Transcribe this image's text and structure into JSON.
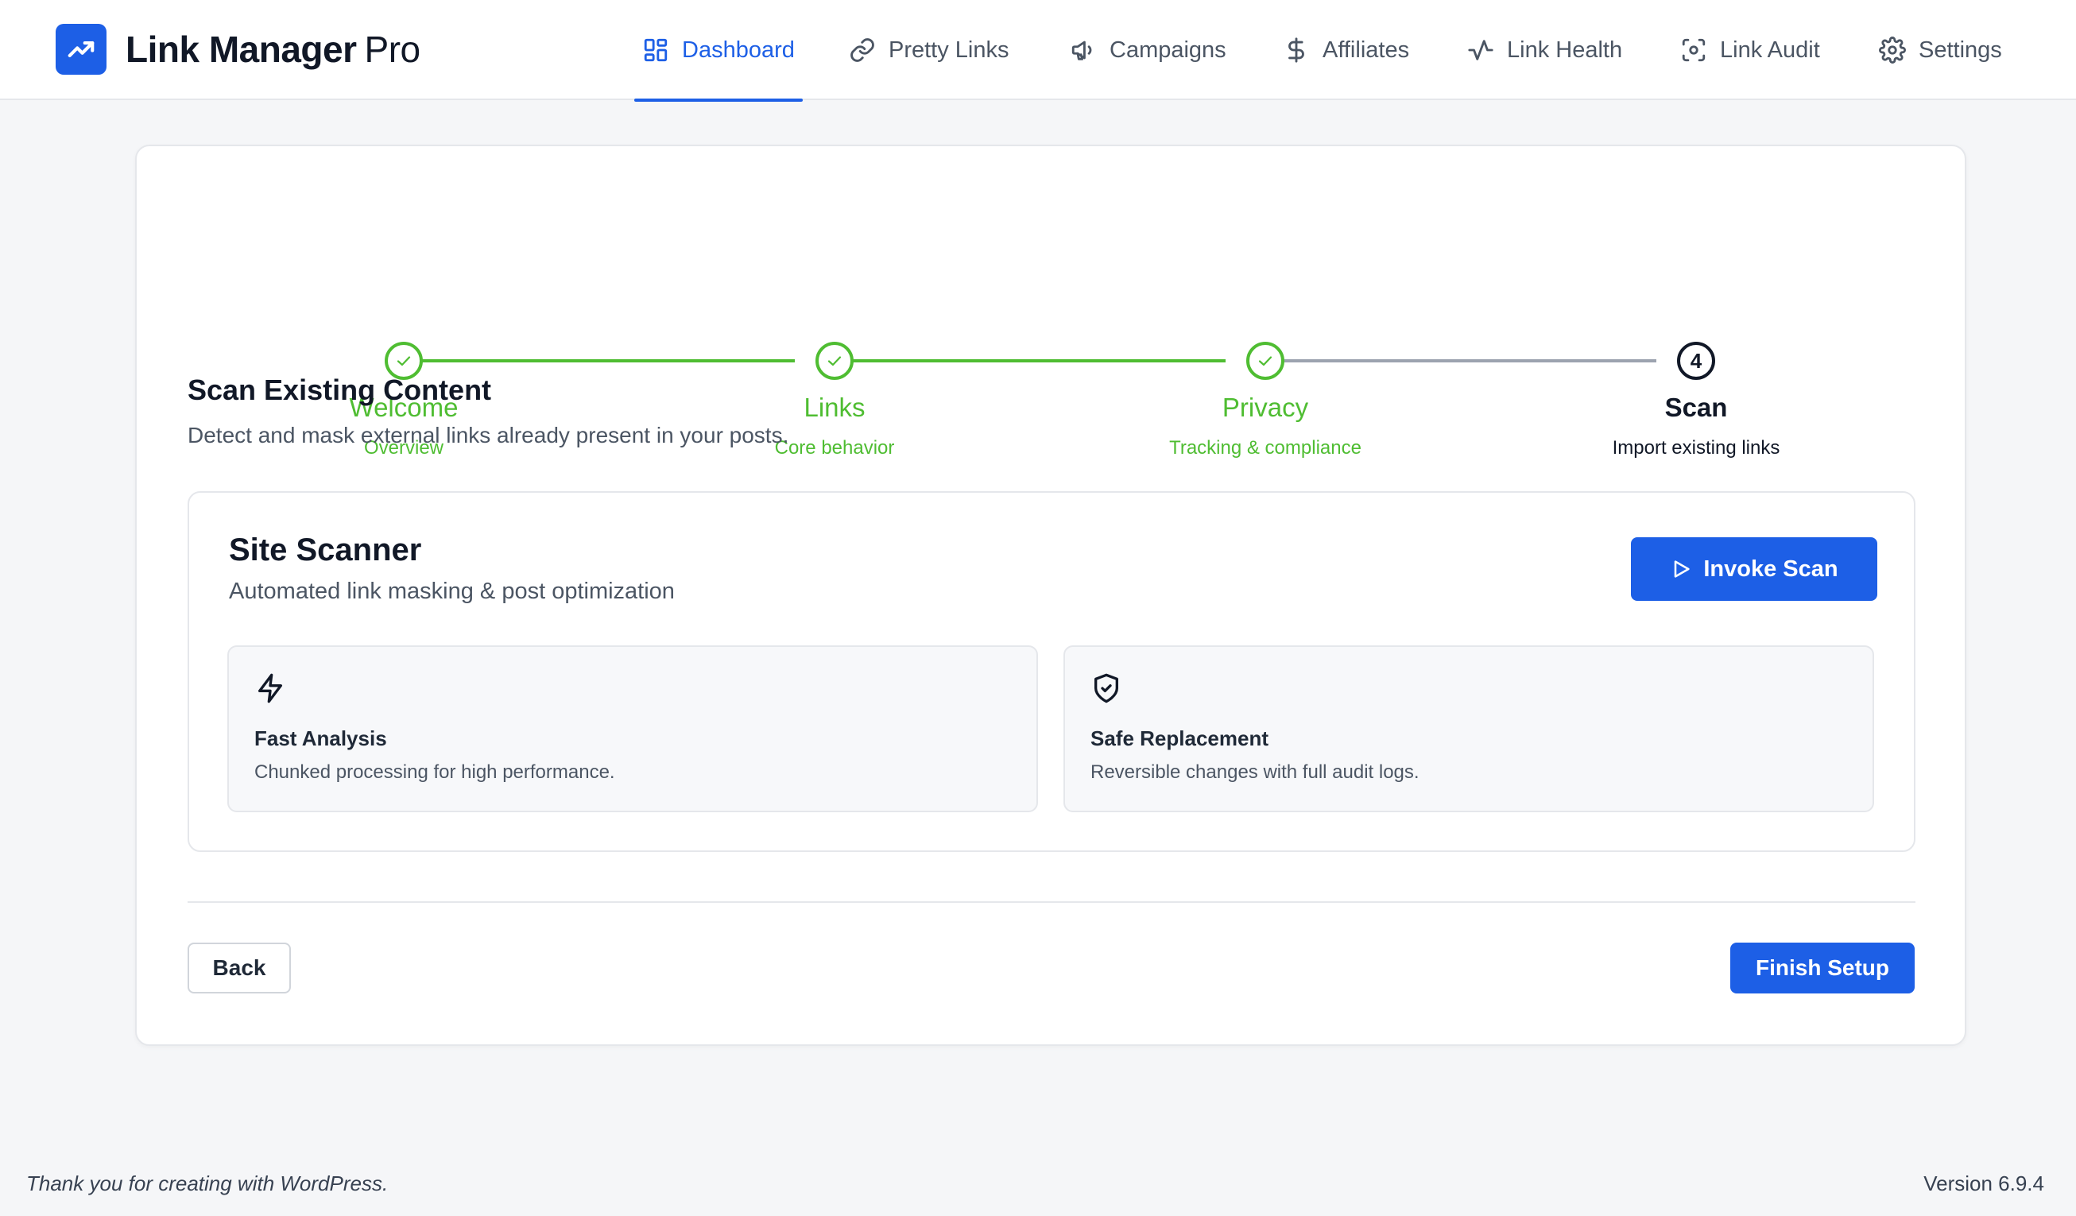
{
  "header": {
    "brand_name": "Link Manager",
    "brand_suffix": "Pro",
    "nav": [
      {
        "label": "Dashboard",
        "icon": "grid-icon",
        "active": true
      },
      {
        "label": "Pretty Links",
        "icon": "link-icon"
      },
      {
        "label": "Campaigns",
        "icon": "megaphone-icon"
      },
      {
        "label": "Affiliates",
        "icon": "dollar-icon"
      },
      {
        "label": "Link Health",
        "icon": "activity-icon"
      },
      {
        "label": "Link Audit",
        "icon": "scan-icon"
      },
      {
        "label": "Settings",
        "icon": "gear-icon"
      }
    ]
  },
  "stepper": {
    "steps": [
      {
        "title": "Welcome",
        "subtitle": "Overview",
        "status": "done"
      },
      {
        "title": "Links",
        "subtitle": "Core behavior",
        "status": "done"
      },
      {
        "title": "Privacy",
        "subtitle": "Tracking & compliance",
        "status": "done"
      },
      {
        "title": "Scan",
        "subtitle": "Import existing links",
        "status": "current",
        "number": "4"
      }
    ]
  },
  "section": {
    "title": "Scan Existing Content",
    "description": "Detect and mask external links already present in your posts."
  },
  "scanner": {
    "title": "Site Scanner",
    "subtitle": "Automated link masking & post optimization",
    "button_label": "Invoke Scan",
    "features": [
      {
        "icon": "lightning-icon",
        "title": "Fast Analysis",
        "description": "Chunked processing for high performance."
      },
      {
        "icon": "shield-check-icon",
        "title": "Safe Replacement",
        "description": "Reversible changes with full audit logs."
      }
    ]
  },
  "actions": {
    "back_label": "Back",
    "finish_label": "Finish Setup"
  },
  "footer": {
    "credit": "Thank you for creating with WordPress.",
    "version": "Version 6.9.4"
  },
  "colors": {
    "primary": "#1d5fe6",
    "success": "#4fbd32",
    "text": "#111827",
    "muted": "#4b5563"
  }
}
